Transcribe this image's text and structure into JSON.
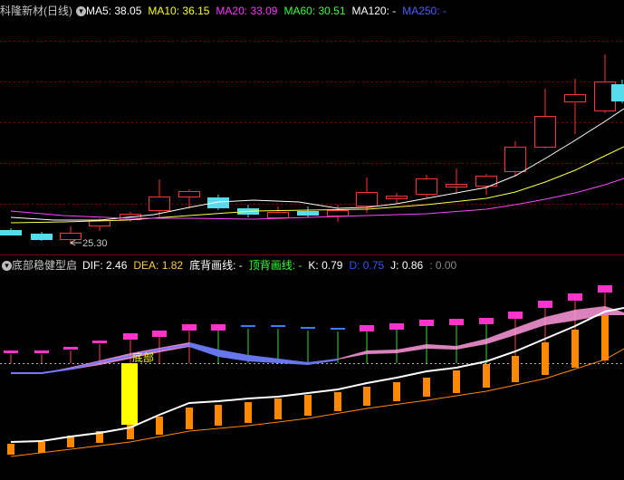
{
  "main": {
    "stock_title": "科隆新材(日线)",
    "ma_items": [
      {
        "label": "MA5: 38.05",
        "color": "#ffffff"
      },
      {
        "label": "MA10: 36.15",
        "color": "#ffff00"
      },
      {
        "label": "MA20: 33.09",
        "color": "#ff33ff"
      },
      {
        "label": "MA60: 30.51",
        "color": "#33ff33"
      },
      {
        "label": "MA120: -",
        "color": "#ffffff"
      },
      {
        "label": "MA250: -",
        "color": "#4a5cff"
      }
    ],
    "low_label": "25.30"
  },
  "indicator": {
    "title": "底部稳健型启",
    "items": [
      {
        "label": "DIF: 2.46",
        "color": "#ffffff"
      },
      {
        "label": "DEA: 1.82",
        "color": "#ffcc33"
      },
      {
        "label": "底背画线: -",
        "color": "#ffffff"
      },
      {
        "label": "顶背画线: -",
        "color": "#33ff33"
      },
      {
        "label": "K: 0.79",
        "color": "#ffffff"
      },
      {
        "label": "D: 0.75",
        "color": "#3355ff"
      },
      {
        "label": "J: 0.86",
        "color": "#ffffff"
      },
      {
        "label": ": 0.00",
        "color": "#888888"
      }
    ],
    "bottom_label": "底部"
  },
  "colors": {
    "up": "#ff3333",
    "down": "#55ddee",
    "grid": "#8a0000",
    "orange": "#ff8800",
    "magenta": "#ff33cc",
    "pink": "#ff99dd",
    "yellow_bar": "#ffff00"
  },
  "icons": {
    "title_dropdown": "chevron-down-icon",
    "indicator_dropdown": "chevron-down-icon"
  }
}
